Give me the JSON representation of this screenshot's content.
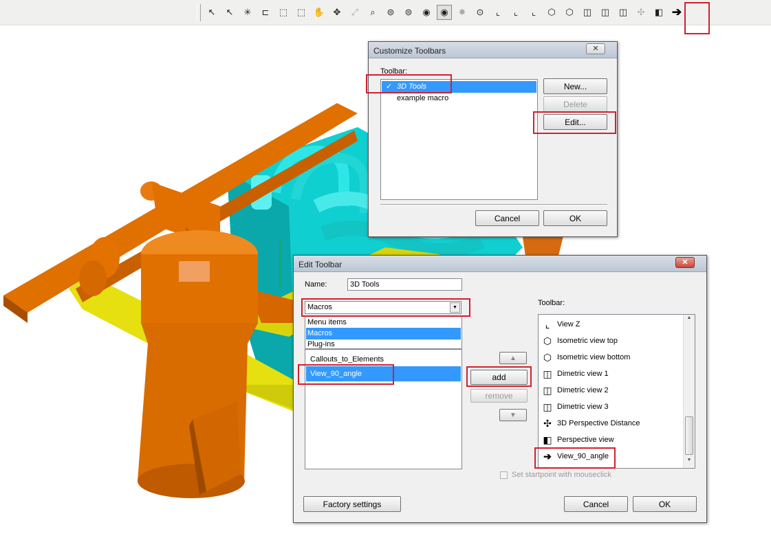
{
  "colors": {
    "orange": "#e06a00",
    "cyan": "#10d8d8",
    "yellow": "#e6e010",
    "highlight": "#3399ff",
    "annotation": "#d0202e"
  },
  "toolbar": {
    "icons": [
      "select-arrow-icon",
      "select-p-icon",
      "select-star-icon",
      "measure-icon",
      "move-box-icon",
      "move-box2-icon",
      "rotate-hand-icon",
      "pan-cross-icon",
      "fit-icon",
      "zoom-icon",
      "cylinder-outline-icon",
      "cylinder-icon",
      "cylinder-shaded-icon",
      "cylinder-active-icon",
      "explode-icon",
      "camera-icon",
      "view-x-icon",
      "view-y-icon",
      "view-z-icon",
      "isometric-top-icon",
      "isometric-bottom-icon",
      "dimetric1-icon",
      "dimetric2-icon",
      "dimetric3-icon",
      "perspective-distance-icon",
      "perspective-view-icon",
      "view-90-angle-icon"
    ],
    "last_icon_glyph": "➔"
  },
  "customize_dialog": {
    "title": "Customize Toolbars",
    "toolbar_label": "Toolbar:",
    "items": [
      {
        "label": "3D Tools",
        "checked": true,
        "selected": true
      },
      {
        "label": "example macro",
        "checked": false,
        "selected": false
      }
    ],
    "check_glyph": "✓",
    "buttons": {
      "new": "New...",
      "delete": "Delete",
      "edit": "Edit...",
      "cancel": "Cancel",
      "ok": "OK"
    },
    "close_glyph": "✕"
  },
  "edit_dialog": {
    "title": "Edit Toolbar",
    "name_label": "Name:",
    "name_value": "3D Tools",
    "category_selected": "Macros",
    "category_options": [
      "Menu items",
      "Macros",
      "Plug-ins"
    ],
    "available_items": [
      "Callouts_to_Elements",
      "View_90_angle"
    ],
    "toolbar_label": "Toolbar:",
    "toolbar_items": [
      {
        "icon": "view-z-icon",
        "glyph": "⌞",
        "label": "View Z"
      },
      {
        "icon": "isometric-top-icon",
        "glyph": "⬡",
        "label": "Isometric view top"
      },
      {
        "icon": "isometric-bottom-icon",
        "glyph": "⬡",
        "label": "Isometric view bottom"
      },
      {
        "icon": "dimetric1-icon",
        "glyph": "◫",
        "label": "Dimetric view 1"
      },
      {
        "icon": "dimetric2-icon",
        "glyph": "◫",
        "label": "Dimetric view 2"
      },
      {
        "icon": "dimetric3-icon",
        "glyph": "◫",
        "label": "Dimetric view 3"
      },
      {
        "icon": "perspective-distance-icon",
        "glyph": "✣",
        "label": "3D Perspective Distance"
      },
      {
        "icon": "perspective-view-icon",
        "glyph": "◧",
        "label": "Perspective view"
      },
      {
        "icon": "view-90-angle-icon",
        "glyph": "➔",
        "label": "View_90_angle"
      }
    ],
    "buttons": {
      "up": "▲",
      "add": "add",
      "remove": "remove",
      "down": "▼",
      "factory": "Factory settings",
      "cancel": "Cancel",
      "ok": "OK"
    },
    "startpoint_label": "Set startpoint with mouseclick",
    "startpoint_checked": false,
    "dropdown_glyph": "▼",
    "scroll_up": "▲",
    "scroll_down": "▼",
    "close_glyph": "✕"
  }
}
